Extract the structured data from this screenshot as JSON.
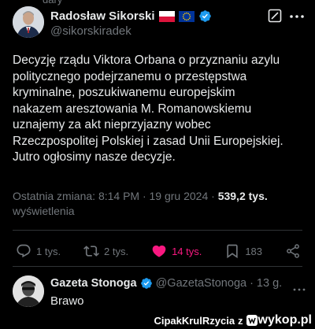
{
  "top_fragment": "dary",
  "tweet": {
    "author_name": "Radosław Sikorski",
    "handle": "@sikorskiradek",
    "text": "Decyzję rządu Viktora Orbana o przyznaniu azylu\npolitycznego podejrzanemu o przestępstwa\nkryminalne, poszukiwanemu europejskim\nnakazem aresztowania M. Romanowskiemu\nuznajemy za akt nieprzyjazny wobec\nRzeczpospolitej Polskiej i zasad Unii Europejskiej.\nJutro ogłosimy nasze decyzje.",
    "last_edit": "Ostatnia zmiana: 8:14 PM · 19 gru 2024 · ",
    "views_count": "539,2 tys.",
    "views_label": "wyświetlenia",
    "icons": [
      "poland-flag-icon",
      "eu-flag-icon",
      "verified-badge-icon",
      "grok-icon",
      "more-icon"
    ]
  },
  "actions": {
    "replies": "1 tys.",
    "reposts": "2 tys.",
    "likes": "14 tys.",
    "bookmarks": "183",
    "icons": [
      "reply-icon",
      "repost-icon",
      "like-icon",
      "bookmark-icon",
      "share-icon"
    ]
  },
  "reply": {
    "author_name": "Gazeta Stonoga",
    "handle": "@GazetaStonoga",
    "time": "· 13 g.",
    "text": "Brawo"
  },
  "watermark": {
    "user": "CipakKrulRzycia",
    "z": "z",
    "site": "wykop.pl"
  },
  "colors": {
    "background": "#000000",
    "text": "#e7e9ea",
    "secondary": "#71767b",
    "verified": "#1d9bf0",
    "like": "#f91880",
    "divider": "#2f3336"
  }
}
